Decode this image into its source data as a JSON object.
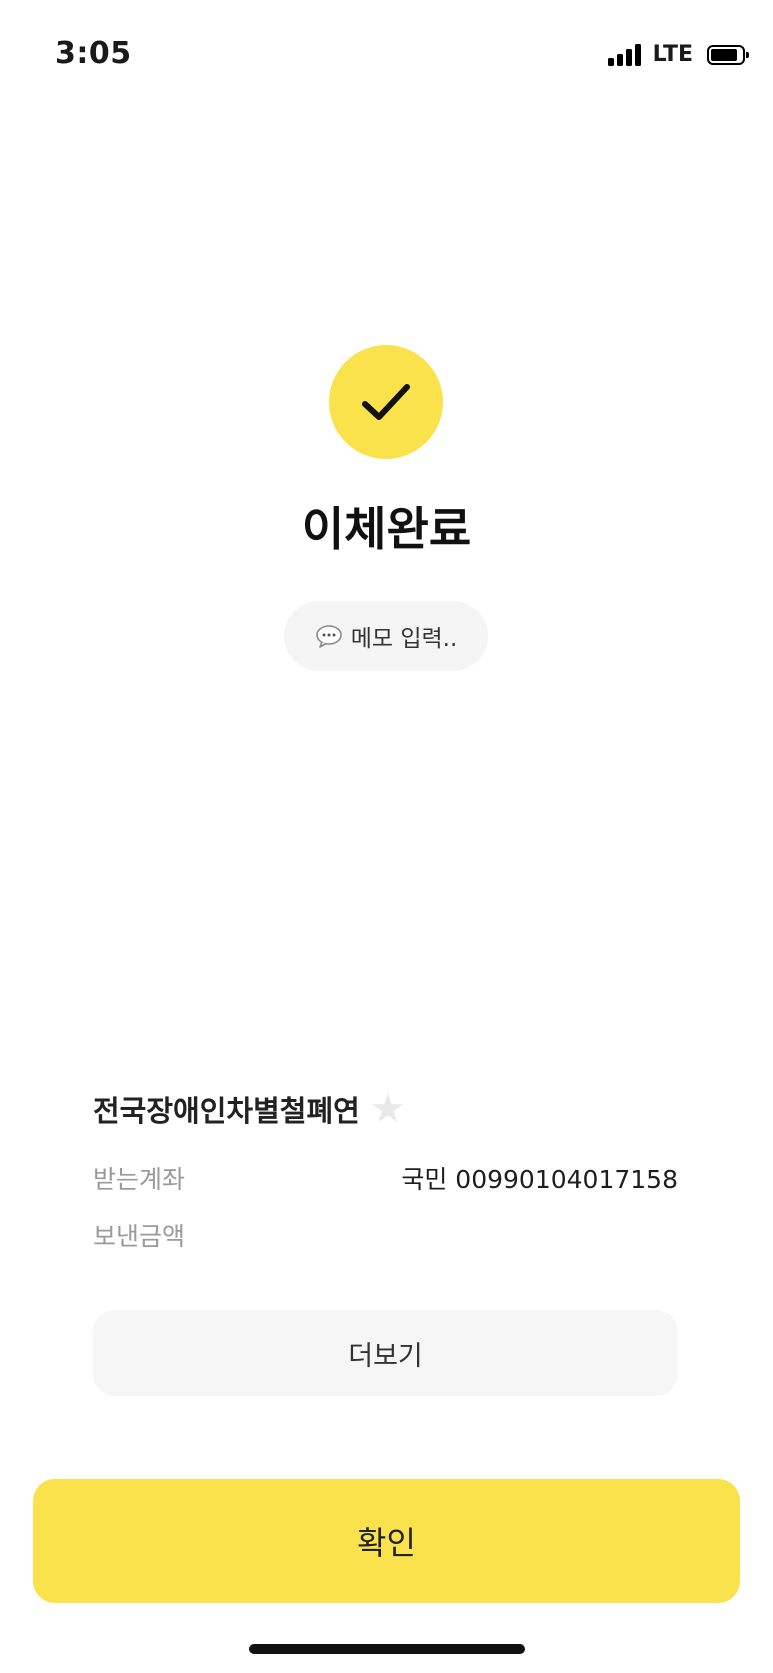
{
  "status_bar": {
    "time": "3:05",
    "network": "LTE",
    "signal_icon": "cellular-signal-icon",
    "battery_icon": "battery-icon"
  },
  "result": {
    "icon": "checkmark-icon",
    "title": "이체완료",
    "accent_color": "#f9e24c"
  },
  "memo": {
    "icon": "speech-bubble-icon",
    "label": "메모 입력.."
  },
  "recipient": {
    "name": "전국장애인차별철폐연",
    "favorite_icon": "star-icon"
  },
  "details": {
    "account_label": "받는계좌",
    "account_value": "국민 00990104017158",
    "amount_label": "보낸금액",
    "amount_value": ""
  },
  "buttons": {
    "more_label": "더보기",
    "confirm_label": "확인"
  }
}
